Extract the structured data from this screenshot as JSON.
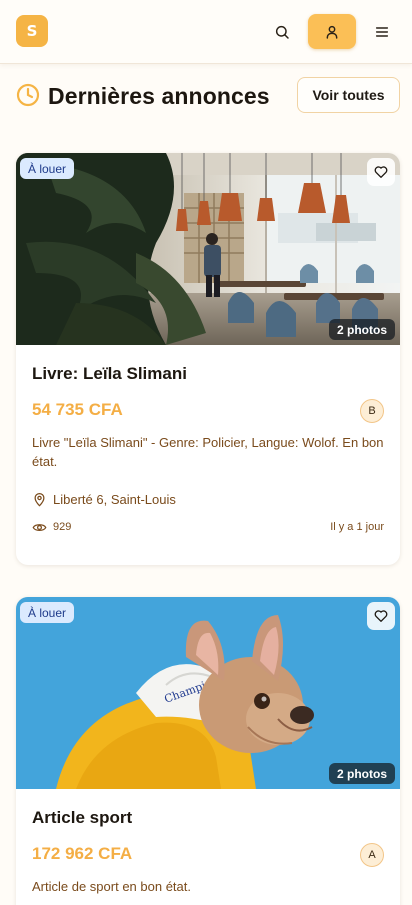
{
  "header": {
    "logo_letter": "S"
  },
  "section": {
    "title": "Dernières annonces",
    "see_all_label": "Voir toutes"
  },
  "listings": [
    {
      "badge": "À louer",
      "photo_count": "2 photos",
      "title": "Livre: Leïla Slimani",
      "price": "54 735 CFA",
      "seller_initial": "B",
      "description": "Livre \"Leïla Slimani\" - Genre: Policier, Langue: Wolof. En bon état.",
      "location": "Liberté 6, Saint-Louis",
      "views": "929",
      "posted": "Il y a 1 jour"
    },
    {
      "badge": "À louer",
      "photo_count": "2 photos",
      "title": "Article sport",
      "price": "172 962 CFA",
      "seller_initial": "A",
      "description": "Article de sport en bon état."
    }
  ],
  "colors": {
    "accent": "#F5B445",
    "price": "#F4AE45",
    "muted_text": "#7A4B1C",
    "rent_badge_bg": "#DBEAFE"
  }
}
